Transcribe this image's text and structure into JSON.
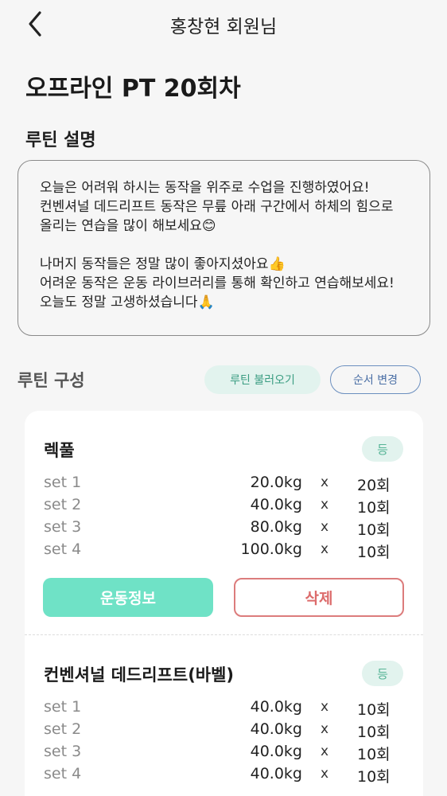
{
  "header": {
    "title": "홍창현 회원님"
  },
  "page_title": "오프라인 PT 20회차",
  "description": {
    "label": "루틴 설명",
    "lines": [
      "오늘은 어려워 하시는 동작을 위주로 수업을 진행하였어요!",
      "컨벤셔널 데드리프트 동작은 무릎 아래 구간에서 하체의 힘으로",
      "올리는 연습을 많이 해보세요😊",
      "",
      "나머지 동작들은 정말 많이 좋아지셨아요👍",
      "어려운 동작은 운동 라이브러리를 통해 확인하고 연습해보세요!",
      "오늘도 정말 고생하셨습니다🙏"
    ]
  },
  "routine": {
    "label": "루틴 구성",
    "load_button": "루틴 불러오기",
    "order_button": "순서 변경"
  },
  "exercises": [
    {
      "name": "렉풀",
      "badge": "등",
      "sets": [
        {
          "label": "set 1",
          "weight": "20.0kg",
          "x": "x",
          "reps": "20회"
        },
        {
          "label": "set 2",
          "weight": "40.0kg",
          "x": "x",
          "reps": "10회"
        },
        {
          "label": "set 3",
          "weight": "80.0kg",
          "x": "x",
          "reps": "10회"
        },
        {
          "label": "set 4",
          "weight": "100.0kg",
          "x": "x",
          "reps": "10회"
        }
      ],
      "info_button": "운동정보",
      "delete_button": "삭제"
    },
    {
      "name": "컨벤셔널 데드리프트(바벨)",
      "badge": "등",
      "sets": [
        {
          "label": "set 1",
          "weight": "40.0kg",
          "x": "x",
          "reps": "10회"
        },
        {
          "label": "set 2",
          "weight": "40.0kg",
          "x": "x",
          "reps": "10회"
        },
        {
          "label": "set 3",
          "weight": "40.0kg",
          "x": "x",
          "reps": "10회"
        },
        {
          "label": "set 4",
          "weight": "40.0kg",
          "x": "x",
          "reps": "10회"
        }
      ]
    }
  ],
  "colors": {
    "accent_mint": "#6fe2c6",
    "badge_bg": "#e2f3ee",
    "delete_red": "#dc7c7c",
    "order_blue": "#6b8fbf"
  },
  "icons": {
    "back": "chevron-left-icon"
  }
}
